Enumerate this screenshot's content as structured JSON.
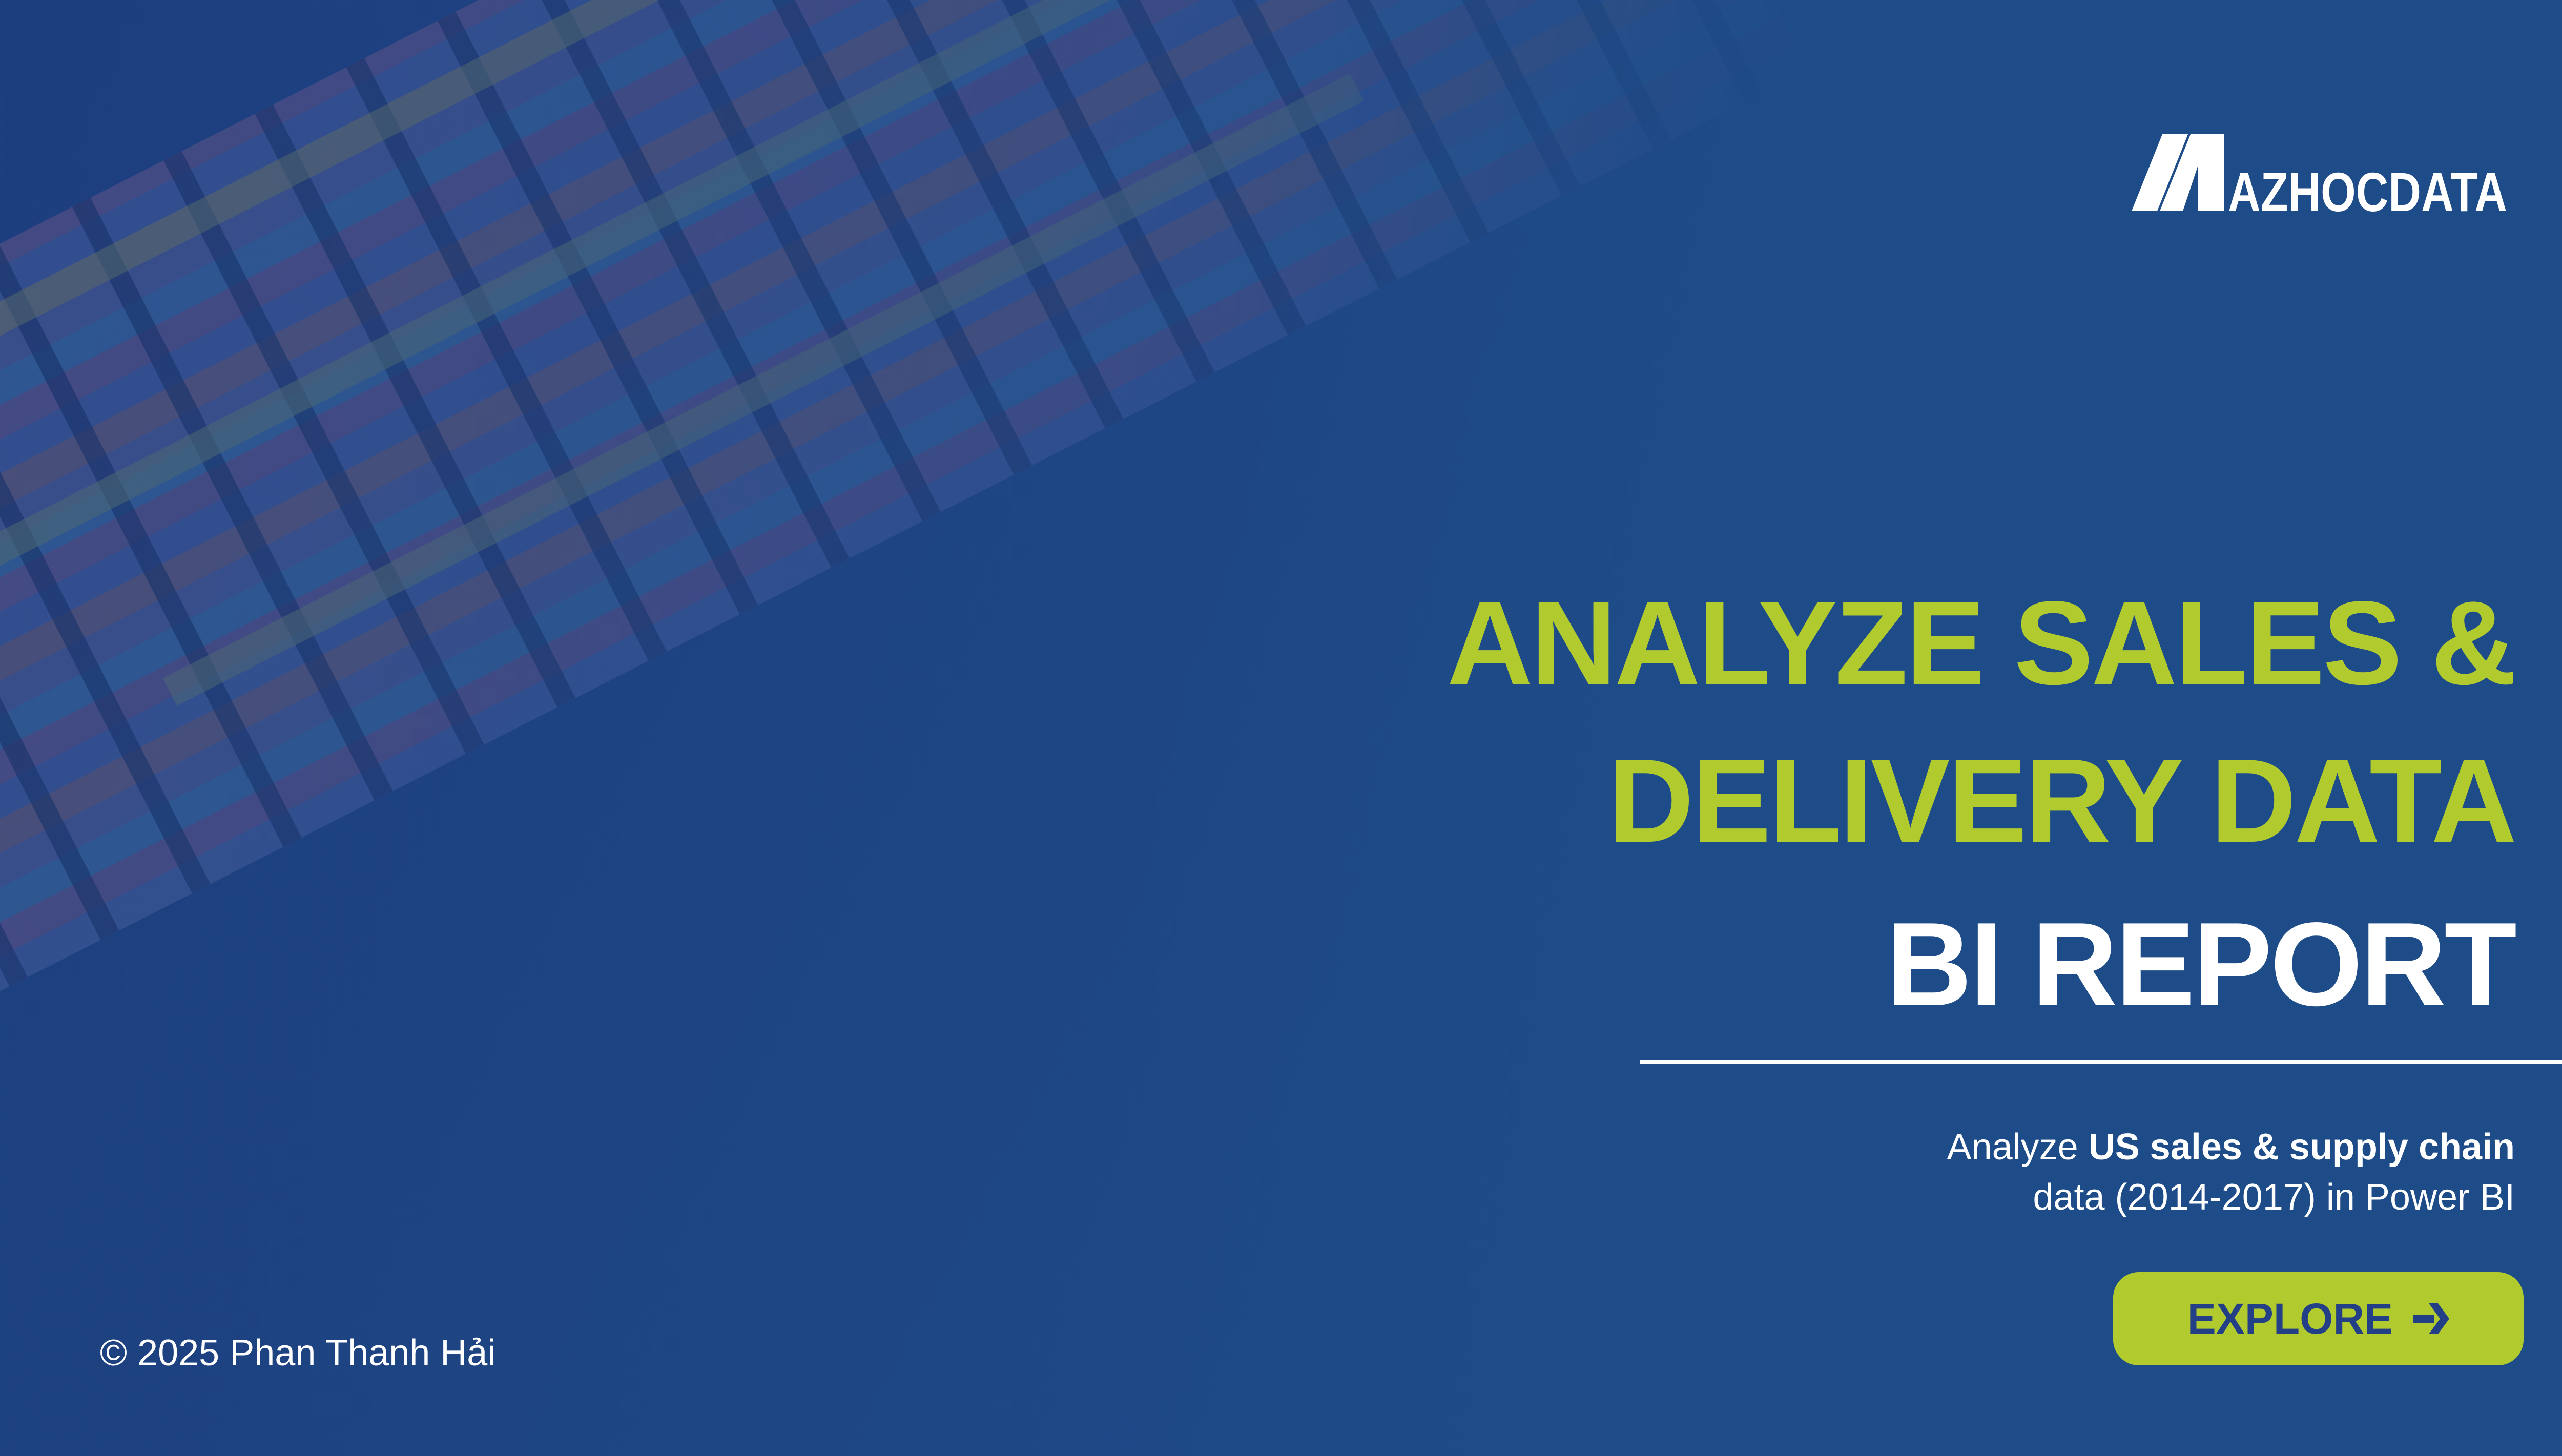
{
  "brand": {
    "logo_text": "MAZHOCDATA"
  },
  "title": {
    "line1": "ANALYZE SALES &",
    "line2": "DELIVERY DATA",
    "line3": "BI REPORT"
  },
  "subtitle": {
    "prefix": "Analyze ",
    "bold": "US sales & supply chain",
    "line2": "data (2014-2017) in Power BI"
  },
  "cta": {
    "label": "EXPLORE",
    "icon": "arrow-right-icon"
  },
  "footer": {
    "copyright": "© 2025 Phan Thanh Hải"
  },
  "colors": {
    "accent": "#b1cb2f",
    "background": "#1e4c88",
    "button_text": "#233f85"
  }
}
